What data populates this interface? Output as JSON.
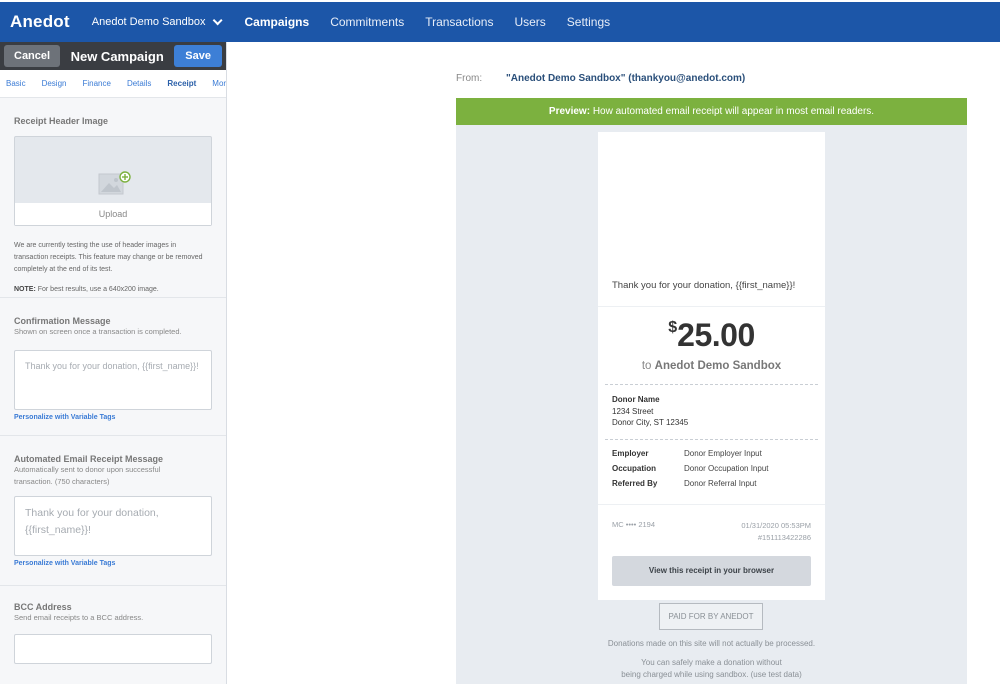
{
  "topnav": {
    "logo": "Anedot",
    "account": "Anedot Demo Sandbox",
    "links": [
      "Campaigns",
      "Commitments",
      "Transactions",
      "Users",
      "Settings"
    ],
    "accent_color": "#1c56a8"
  },
  "panel": {
    "cancel_label": "Cancel",
    "title": "New Campaign",
    "save_label": "Save",
    "tabs": [
      "Basic",
      "Design",
      "Finance",
      "Details",
      "Receipt",
      "More"
    ],
    "active_tab": "Receipt"
  },
  "receipt_header": {
    "title": "Receipt Header Image",
    "upload_label": "Upload",
    "note": "We are currently testing the use of header images in transaction receipts. This feature may change or be removed completely at the end of its test.",
    "note_label": "NOTE:",
    "note_text": "For best results, use a 640x200 image."
  },
  "confirmation": {
    "title": "Confirmation Message",
    "subtitle": "Shown on screen once a transaction is completed.",
    "placeholder": "Thank you for your donation, {{first_name}}!",
    "link": "Personalize with Variable Tags"
  },
  "email_receipt": {
    "title": "Automated Email Receipt Message",
    "subtitle": "Automatically sent to donor upon successful transaction. (750 characters)",
    "placeholder": "Thank you for your donation, {{first_name}}!",
    "link": "Personalize with Variable Tags"
  },
  "bcc": {
    "title": "BCC Address",
    "subtitle": "Send email receipts to a BCC address."
  },
  "preview": {
    "from_label": "From:",
    "from_value": "\"Anedot Demo Sandbox\" (thankyou@anedot.com)",
    "bar_bold": "Preview:",
    "bar_text": "How automated email receipt will appear in most email readers.",
    "bar_color": "#7cb13f"
  },
  "receipt": {
    "thanks": "Thank you for your donation, {{first_name}}!",
    "currency": "$",
    "amount": "25.00",
    "to_prefix": "to",
    "to_org": "Anedot Demo Sandbox",
    "donor_name": "Donor Name",
    "street": "1234 Street",
    "city": "Donor City, ST 12345",
    "fields": [
      {
        "key": "Employer",
        "value": "Donor Employer Input"
      },
      {
        "key": "Occupation",
        "value": "Donor Occupation Input"
      },
      {
        "key": "Referred By",
        "value": "Donor Referral Input"
      }
    ],
    "card": "MC •••• 2194",
    "datetime": "01/31/2020 05:53PM",
    "txn_id": "#151113422286",
    "view_button": "View this receipt in your browser",
    "paid_badge": "PAID FOR BY ANEDOT",
    "notice1": "Donations made on this site will not actually be processed.",
    "notice2": "You can safely make a donation without",
    "notice3": "being charged while using sandbox. (use test data)"
  }
}
